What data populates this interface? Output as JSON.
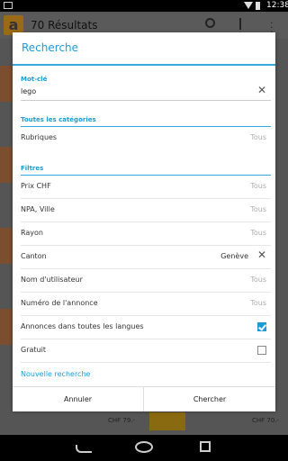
{
  "status_bar": {
    "time": "12:38"
  },
  "app_bar": {
    "logo_letter": "a",
    "title": "70 Résultats"
  },
  "background": {
    "prices": [
      "CHF 79.-",
      "CHF 70.-"
    ]
  },
  "dialog": {
    "title": "Recherche",
    "keyword": {
      "label": "Mot-clé",
      "value": "lego"
    },
    "categories": {
      "label": "Toutes les catégories",
      "rows": [
        {
          "label": "Rubriques",
          "value": "Tous"
        }
      ]
    },
    "filters": {
      "label": "Filtres",
      "rows": [
        {
          "label": "Prix CHF",
          "value": "Tous"
        },
        {
          "label": "NPA, Ville",
          "value": "Tous"
        },
        {
          "label": "Rayon",
          "value": "Tous"
        },
        {
          "label": "Canton",
          "value": "Genève"
        },
        {
          "label": "Nom d'utilisateur",
          "value": "Tous"
        },
        {
          "label": "Numéro de l'annonce",
          "value": "Tous"
        },
        {
          "label": "Annonces dans toutes les langues",
          "checked": true
        },
        {
          "label": "Gratuit",
          "checked": false
        }
      ]
    },
    "new_search": "Nouvelle recherche",
    "buttons": {
      "cancel": "Annuler",
      "search": "Chercher"
    }
  },
  "colors": {
    "accent": "#1a9dd6",
    "divider": "#33a9e0"
  }
}
